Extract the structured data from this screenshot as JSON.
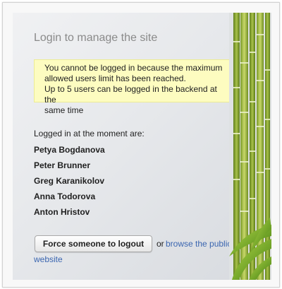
{
  "title": "Login to manage the site",
  "notice": {
    "line1": "You cannot be logged in because the maximum",
    "line2": "allowed users limit has been reached.",
    "line3": "Up to 5 users can be logged in the backend at the",
    "line4": "same time"
  },
  "logged_in_label": "Logged in at the moment are:",
  "users": [
    "Petya Bogdanova",
    "Peter Brunner",
    "Greg Karanikolov",
    "Anna Todorova",
    "Anton Hristov"
  ],
  "actions": {
    "force_logout_label": "Force someone to logout",
    "or_text": "or",
    "browse_link_part1": "browse the public",
    "browse_link_part2": "website"
  },
  "colors": {
    "notice_bg": "#fdfcc0",
    "link": "#3b66b0",
    "title": "#8a8a8a"
  }
}
